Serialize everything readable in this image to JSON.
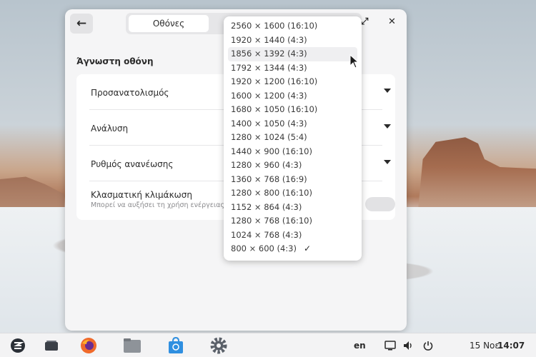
{
  "window": {
    "tab_active": "Οθόνες",
    "section_title": "Άγνωστη οθόνη",
    "rows": [
      {
        "label": "Προσανατολισμός"
      },
      {
        "label": "Ανάλυση"
      },
      {
        "label": "Ρυθμός ανανέωσης"
      },
      {
        "label": "Κλασματική κλιμάκωση",
        "sub": "Μπορεί να αυξήσει τη χρήση ενέργειας"
      }
    ]
  },
  "dropdown": {
    "options": [
      "2560 × 1600 (16:10)",
      "1920 × 1440 (4:3)",
      "1856 × 1392 (4:3)",
      "1792 × 1344 (4:3)",
      "1920 × 1200 (16:10)",
      "1600 × 1200 (4:3)",
      "1680 × 1050 (16:10)",
      "1400 × 1050 (4:3)",
      "1280 × 1024 (5:4)",
      "1440 × 900 (16:10)",
      "1280 × 960 (4:3)",
      "1360 × 768 (16:9)",
      "1280 × 800 (16:10)",
      "1152 × 864 (4:3)",
      "1280 × 768 (16:10)",
      "1024 × 768 (4:3)",
      "800 × 600 (4:3)"
    ],
    "selected_index": 16,
    "hover_index": 2
  },
  "taskbar": {
    "language": "en",
    "date": "15 Νοε",
    "time": "14:07"
  },
  "colors": {
    "accent_blue": "#2f8fe0",
    "firefox_orange": "#f06a2b"
  }
}
